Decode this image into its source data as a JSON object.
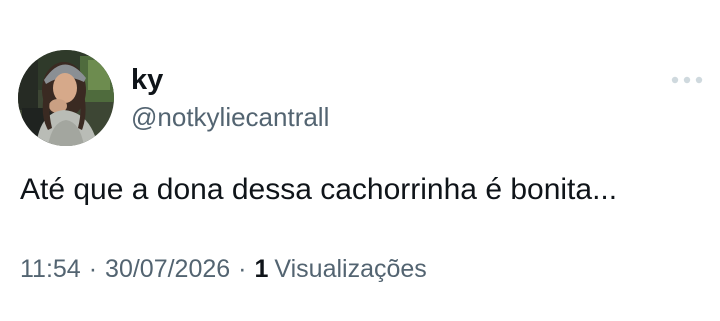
{
  "tweet": {
    "author": {
      "display_name": "ky",
      "handle": "@notkyliecantrall"
    },
    "text": "Até que a dona dessa cachorrinha é bonita...",
    "time": "11:54",
    "date": "30/07/2026",
    "separator": "·",
    "views_count": "1",
    "views_label": "Visualizações",
    "more_icon": "more-horizontal-icon"
  },
  "colors": {
    "text_primary": "#0f1419",
    "text_secondary": "#536471",
    "more_icon": "#cfd9de",
    "background": "#ffffff"
  }
}
